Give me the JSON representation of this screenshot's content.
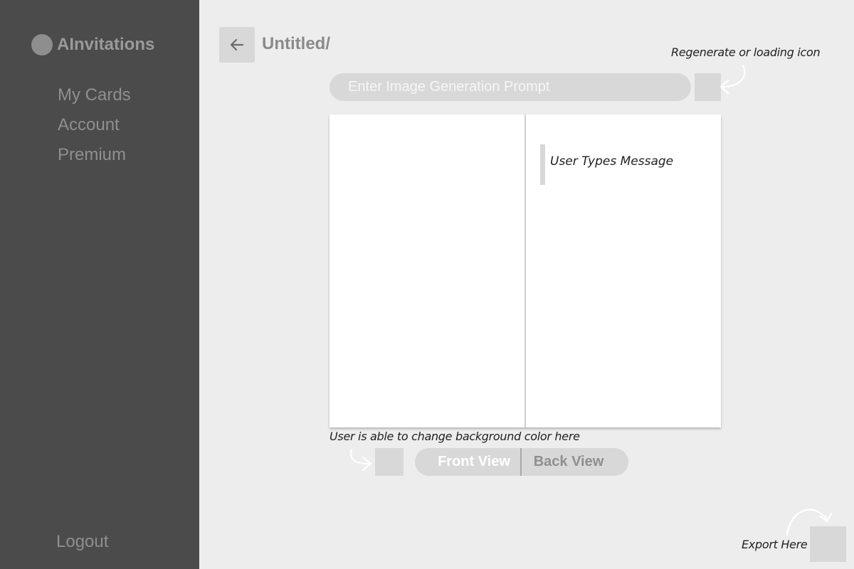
{
  "sidebar": {
    "brand": "AInvitations",
    "items": [
      {
        "label": "My Cards"
      },
      {
        "label": "Account"
      },
      {
        "label": "Premium"
      }
    ],
    "logout": "Logout"
  },
  "header": {
    "back_icon": "arrow-left-icon",
    "title": "Untitled/"
  },
  "prompt": {
    "placeholder": "Enter Image Generation Prompt",
    "value": ""
  },
  "card": {
    "message": "User Types Message"
  },
  "annotations": {
    "regenerate": "Regenerate or loading icon",
    "background": "User is able to change background color here",
    "export": "Export Here"
  },
  "view_toggle": {
    "front": "Front View",
    "back": "Back View",
    "selected": "Front View"
  },
  "colors": {
    "sidebar_bg": "#4b4b4b",
    "page_bg": "#ededed",
    "control_bg": "#d8d8d8"
  }
}
